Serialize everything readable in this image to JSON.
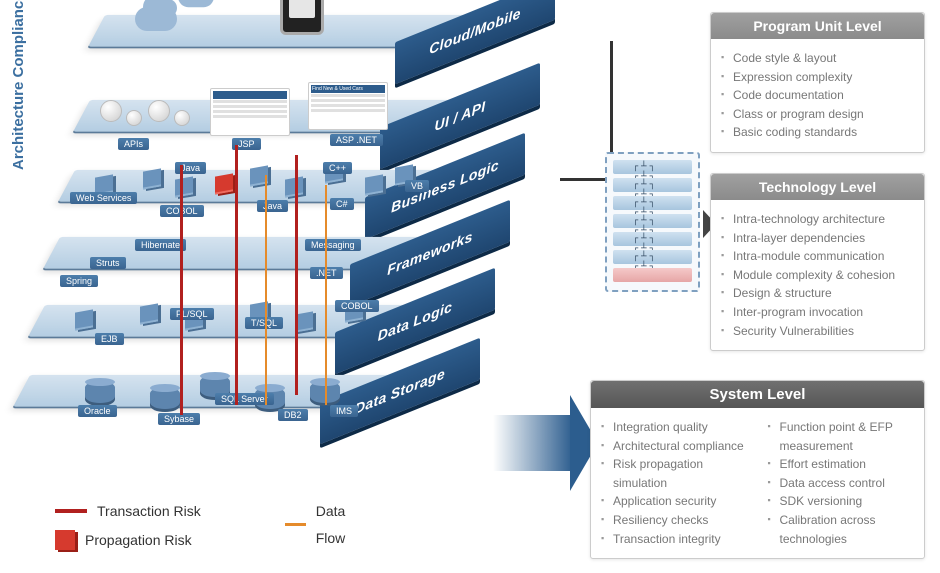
{
  "vertical_label": "Architecture Compliance",
  "layers": [
    {
      "name": "Cloud/Mobile"
    },
    {
      "name": "UI / API"
    },
    {
      "name": "Business Logic"
    },
    {
      "name": "Frameworks"
    },
    {
      "name": "Data Logic"
    },
    {
      "name": "Data Storage"
    }
  ],
  "ui_layer_tech": [
    "APIs",
    "JSP",
    "ASP .NET"
  ],
  "business_layer_tech": [
    "Web Services",
    "COBOL",
    "Java",
    "Java",
    "C++",
    "C#",
    "VB"
  ],
  "frameworks_layer_tech": [
    "Spring",
    "Struts",
    "Hibernate",
    "Messaging",
    ".NET"
  ],
  "data_logic_layer_tech": [
    "EJB",
    "PL/SQL",
    "T/SQL",
    "COBOL"
  ],
  "data_storage_layer_tech": [
    "Oracle",
    "Sybase",
    "SQL Server",
    "DB2",
    "IMS"
  ],
  "thumb_header": "Find New & Used Cars",
  "legend": {
    "transaction_risk": "Transaction Risk",
    "propagation_risk": "Propagation Risk",
    "data_flow": "Data Flow"
  },
  "panels": {
    "program_unit": {
      "title": "Program Unit Level",
      "items": [
        "Code style & layout",
        "Expression complexity",
        "Code documentation",
        "Class or program design",
        "Basic coding standards"
      ]
    },
    "technology": {
      "title": "Technology Level",
      "items": [
        "Intra-technology architecture",
        "Intra-layer dependencies",
        "Intra-module communication",
        "Module complexity & cohesion",
        "Design & structure",
        "Inter-program invocation",
        "Security Vulnerabilities"
      ]
    },
    "system": {
      "title": "System Level",
      "col1": [
        "Integration quality",
        "Architectural compliance",
        "Risk propagation simulation",
        "Application security",
        "Resiliency checks",
        "Transaction integrity"
      ],
      "col2": [
        "Function point & EFP measurement",
        "Effort estimation",
        "Data access control",
        "SDK versioning",
        "Calibration across technologies"
      ]
    }
  }
}
